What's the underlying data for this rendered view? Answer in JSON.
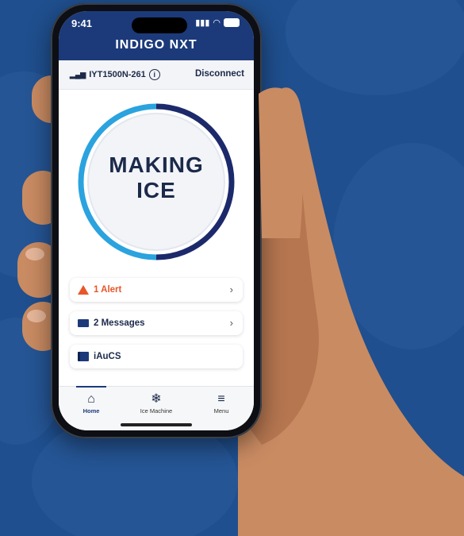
{
  "status_bar": {
    "time": "9:41"
  },
  "brand": {
    "logo_text": "INDIGO NXT"
  },
  "device": {
    "name": "IYT1500N-261",
    "disconnect_label": "Disconnect"
  },
  "ice_status": {
    "line1": "MAKING",
    "line2": "ICE"
  },
  "cards": [
    {
      "label": "1 Alert",
      "color": "#e8562a"
    },
    {
      "label": "2 Messages",
      "color": "#1c2a4a"
    },
    {
      "label": "iAuCS",
      "color": "#1c2a4a"
    }
  ],
  "tabs": [
    {
      "label": "Home",
      "icon": "home-icon"
    },
    {
      "label": "Ice Machine",
      "icon": "snowflake-icon"
    },
    {
      "label": "Menu",
      "icon": "hamburger-menu-icon"
    }
  ],
  "colors": {
    "background": "#1f4f8e",
    "brand": "#1c3a7a",
    "accent": "#2aa3df",
    "alert": "#e8562a"
  }
}
